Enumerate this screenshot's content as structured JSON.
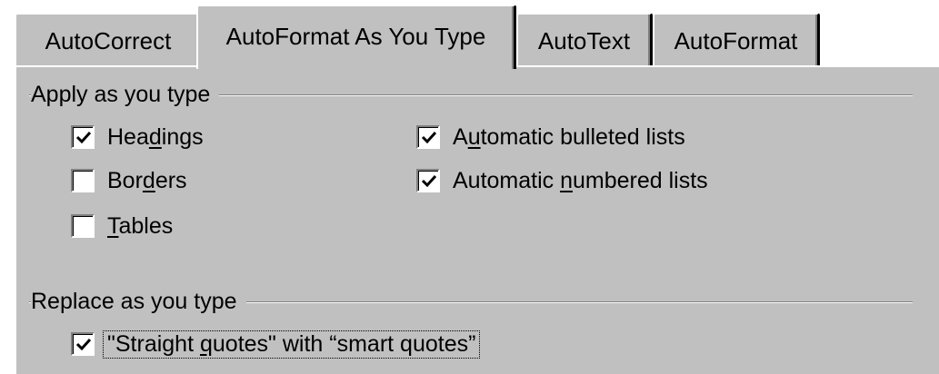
{
  "tabs": [
    {
      "id": "autocorrect",
      "label": "AutoCorrect",
      "active": false
    },
    {
      "id": "autoformat-as-you-type",
      "label": "AutoFormat As You Type",
      "active": true
    },
    {
      "id": "autotext",
      "label": "AutoText",
      "active": false
    },
    {
      "id": "autoformat",
      "label": "AutoFormat",
      "active": false
    }
  ],
  "apply_group": {
    "label": "Apply as you type",
    "items": {
      "headings": {
        "pre": "Hea",
        "mn": "d",
        "post": "ings",
        "checked": true
      },
      "borders": {
        "pre": "Bor",
        "mn": "d",
        "post": "ers",
        "checked": false
      },
      "tables": {
        "pre": "",
        "mn": "T",
        "post": "ables",
        "checked": false
      },
      "bulleted": {
        "pre": "A",
        "mn": "u",
        "post": "tomatic bulleted lists",
        "checked": true
      },
      "numbered": {
        "pre": "Automatic ",
        "mn": "n",
        "post": "umbered lists",
        "checked": true
      }
    }
  },
  "replace_group": {
    "label": "Replace as you type",
    "items": {
      "quotes": {
        "pre": "\"Straight ",
        "mn": "q",
        "post": "uotes\" with “smart quotes”",
        "checked": true
      }
    }
  },
  "colors": {
    "face": "#c0c0c0",
    "highlight": "#ffffff",
    "shadow": "#808080",
    "dark": "#000000"
  },
  "icons": {
    "checkmark": "checkmark-icon"
  }
}
